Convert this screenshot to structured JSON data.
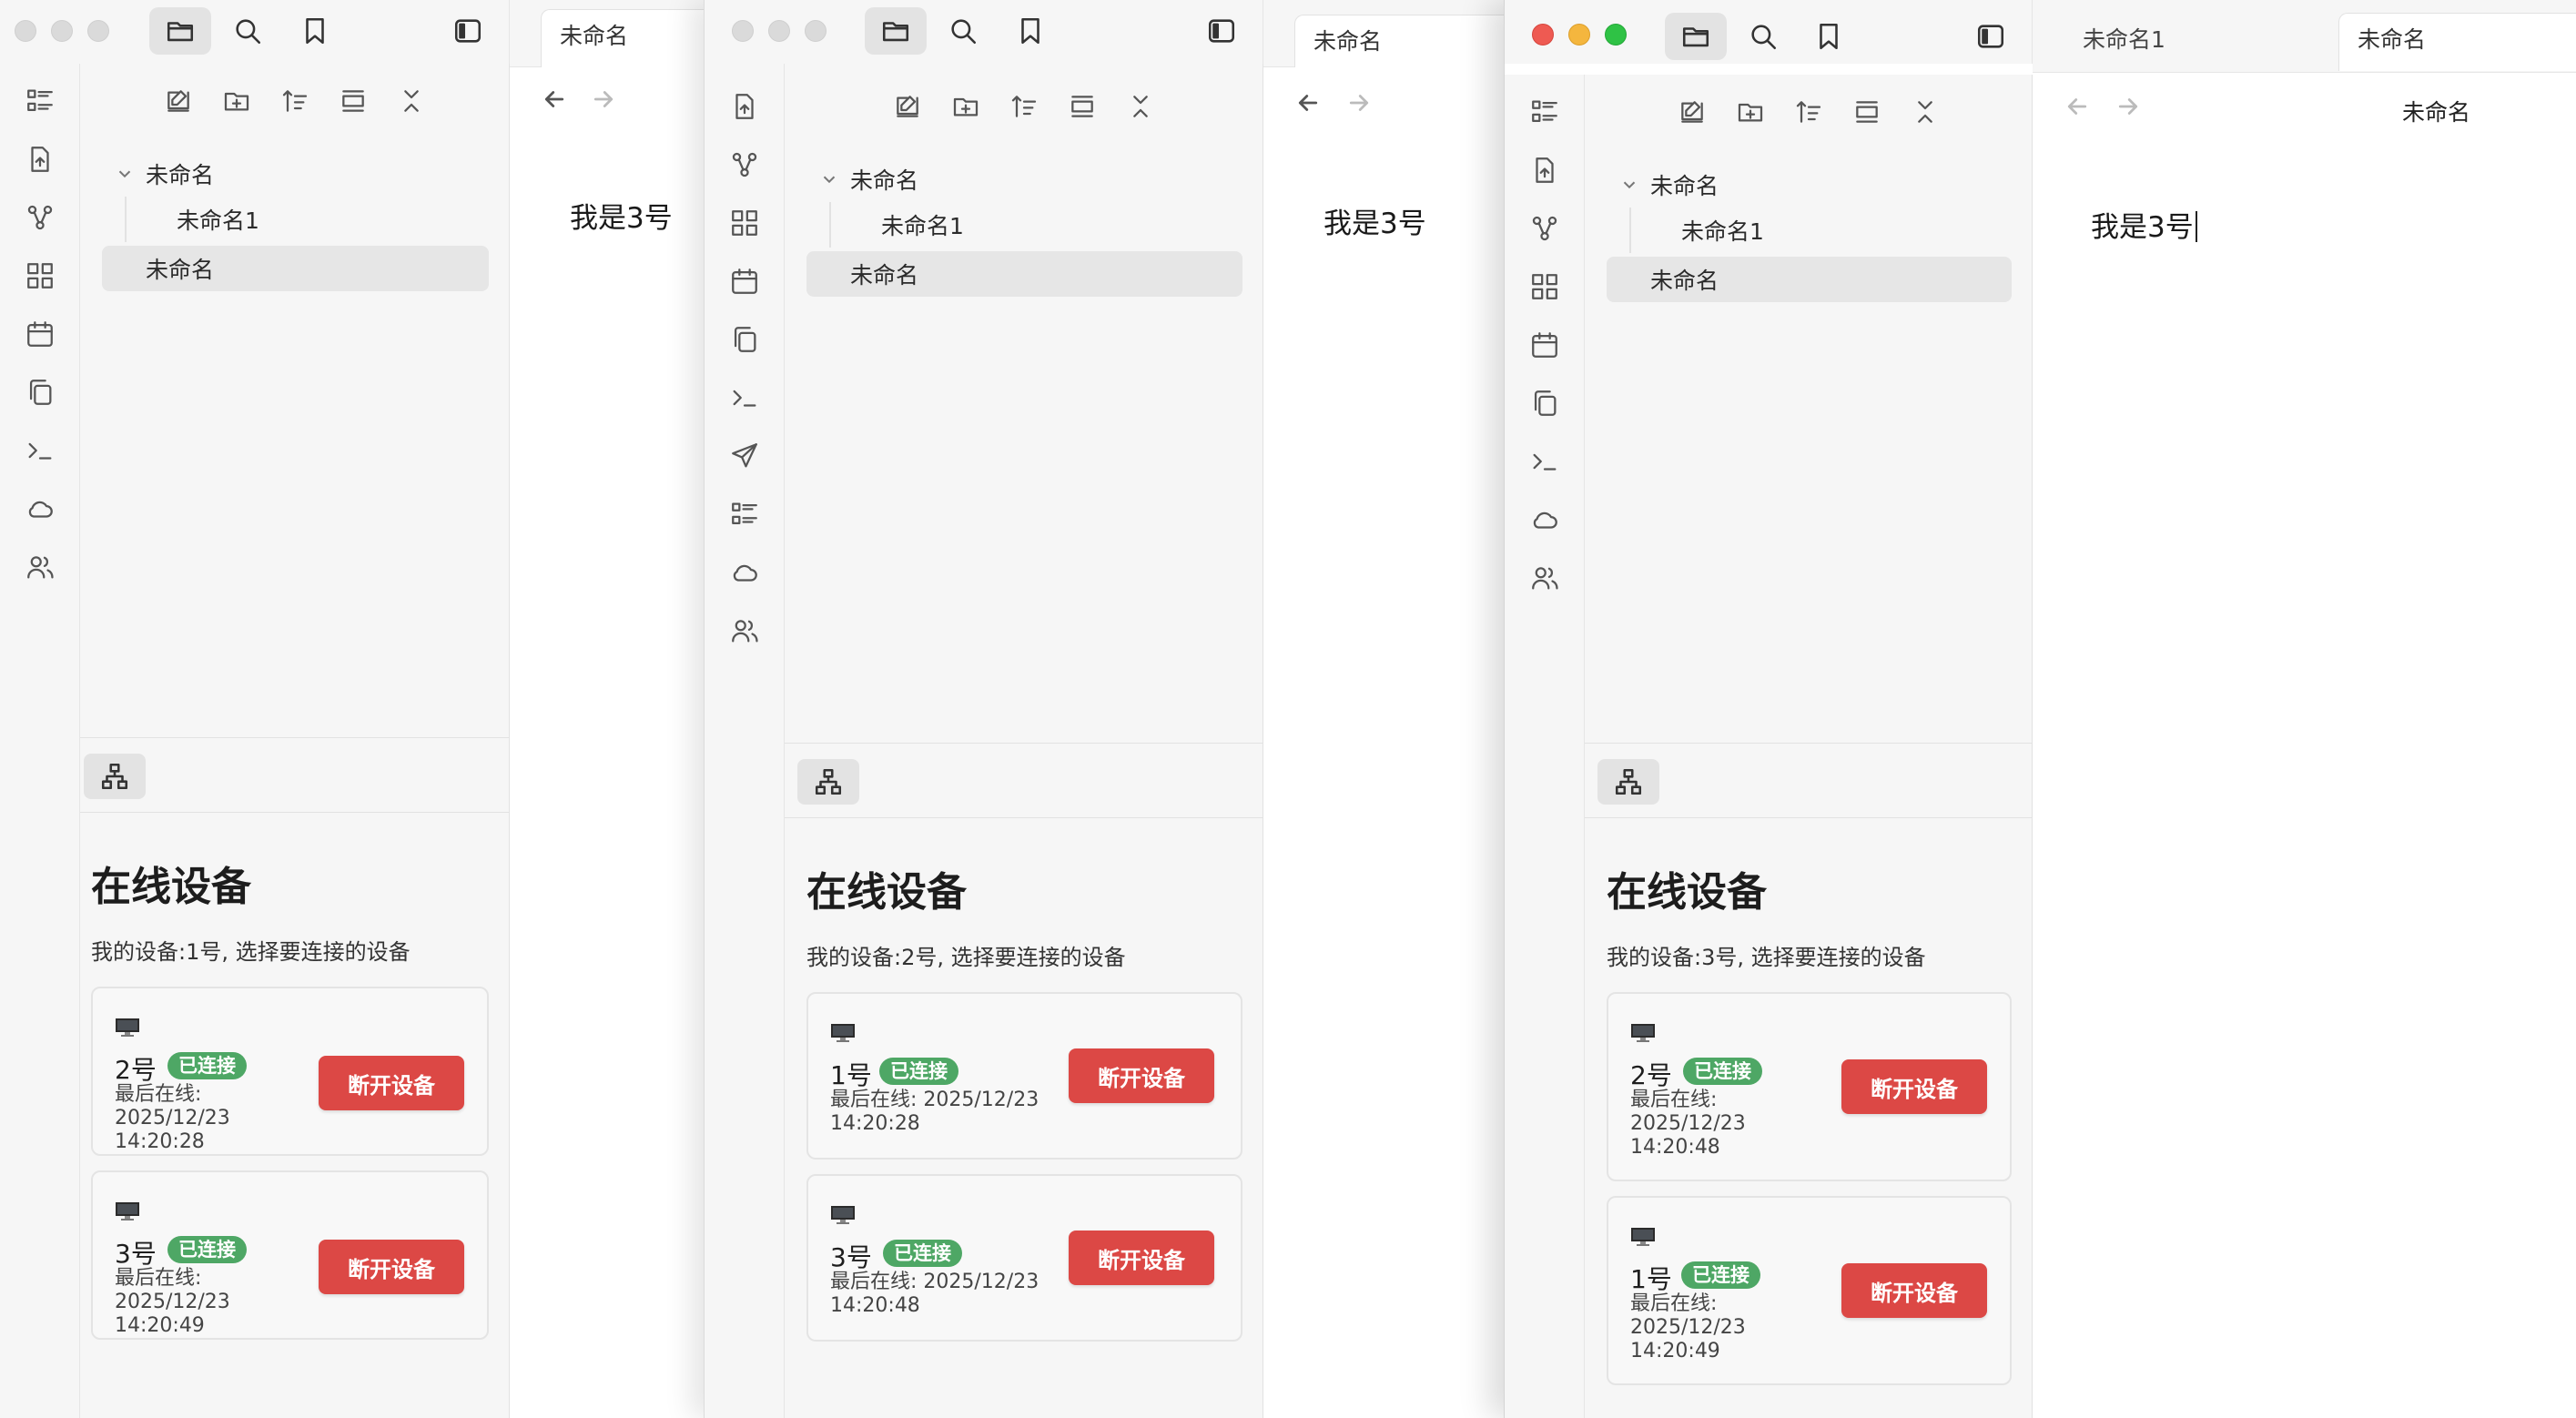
{
  "tree": {
    "folder": "未命名",
    "child": "未命名1",
    "file": "未命名"
  },
  "panel": {
    "title": "在线设备",
    "status_label": "已连接",
    "last_seen_label": "最后在线:",
    "disconnect_label": "断开设备",
    "monitor_icon": "monitor-icon"
  },
  "windows": [
    {
      "my_device": "我的设备:1号, 选择要连接的设备",
      "devices": [
        {
          "name": "2号",
          "date": "2025/12/23",
          "time": "14:20:28"
        },
        {
          "name": "3号",
          "date": "2025/12/23",
          "time": "14:20:49"
        }
      ],
      "tabs": [
        "未命名"
      ],
      "content": "我是3号"
    },
    {
      "my_device": "我的设备:2号, 选择要连接的设备",
      "devices": [
        {
          "name": "1号",
          "last_seen": "最后在线: 2025/12/23",
          "time": "14:20:28"
        },
        {
          "name": "3号",
          "last_seen": "最后在线: 2025/12/23",
          "time": "14:20:48"
        }
      ],
      "tabs": [
        "未命名"
      ],
      "content": "我是3号"
    },
    {
      "my_device": "我的设备:3号, 选择要连接的设备",
      "devices": [
        {
          "name": "2号",
          "date": "2025/12/23",
          "time": "14:20:48"
        },
        {
          "name": "1号",
          "date": "2025/12/23",
          "time": "14:20:49"
        }
      ],
      "tabs": [
        "未命名1",
        "未命名"
      ],
      "header_title": "未命名",
      "content": "我是3号"
    }
  ],
  "colors": {
    "badge": "#4ea765",
    "disconnect": "#dc4845",
    "close": "#ee5a52",
    "minimize": "#f4b63e",
    "zoom": "#2fc245"
  }
}
